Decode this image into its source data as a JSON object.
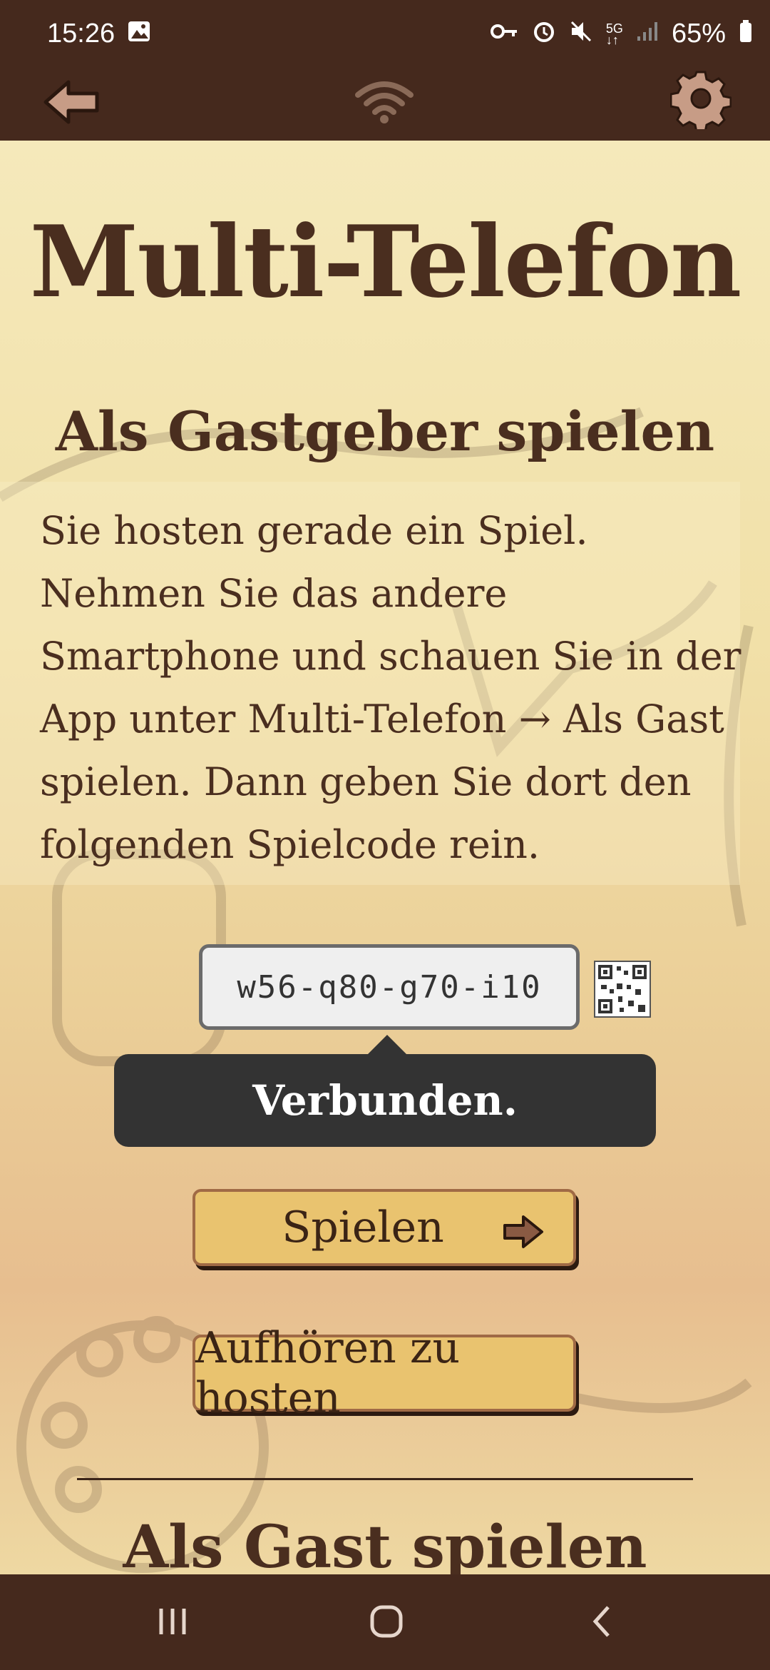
{
  "status_bar": {
    "time": "15:26",
    "battery": "65%",
    "icons": [
      "image-icon",
      "key-icon",
      "alarm-icon",
      "mute-icon",
      "5g-icon",
      "signal-icon",
      "battery-icon"
    ]
  },
  "toolbar": {
    "back_icon": "back-arrow-icon",
    "wifi_icon": "wifi-icon",
    "settings_icon": "gear-icon"
  },
  "main": {
    "title": "Multi-Telefon",
    "subtitle": "Als Gastgeber spielen",
    "description": "Sie hosten gerade ein Spiel. Nehmen Sie das andere Smartphone und schauen Sie in der App unter Multi-Telefon → Als Gast spielen. Dann geben Sie dort den folgenden Spielcode rein.",
    "game_code": "w56-q80-g70-i10",
    "tooltip": "Verbunden.",
    "play_button": "Spielen",
    "stop_hosting_button": "Aufhören zu hosten",
    "next_section_heading": "Als Gast spielen"
  },
  "colors": {
    "bar_brown": "#45291d",
    "text_brown": "#4a2e1f",
    "button_gold": "#e9c36f",
    "tooltip_dark": "#333333"
  }
}
